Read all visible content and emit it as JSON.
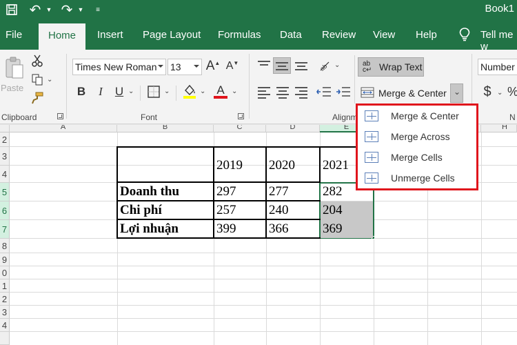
{
  "window": {
    "title": "Book1",
    "undo_icon": "↶",
    "redo_icon": "↷"
  },
  "tabs": [
    "File",
    "Home",
    "Insert",
    "Page Layout",
    "Formulas",
    "Data",
    "Review",
    "View",
    "Help"
  ],
  "tell_me": "Tell me w",
  "ribbon": {
    "clipboard": {
      "paste_label": "Paste",
      "group_label": "Clipboard"
    },
    "font": {
      "font_name": "Times New Roman",
      "font_size": "13",
      "bold": "B",
      "italic": "I",
      "underline": "U",
      "grow": "A",
      "shrink": "A",
      "font_color_letter": "A",
      "group_label": "Font",
      "highlight_color": "#ffff00",
      "font_color": "#e0141c"
    },
    "alignment": {
      "wrap_text_label": "Wrap Text",
      "wrap_text_icon": "ab c",
      "merge_center_label": "Merge & Center",
      "group_label": "Alignm"
    },
    "number": {
      "format": "Number",
      "currency": "$",
      "percent": "%",
      "group_label": "N"
    }
  },
  "merge_menu": {
    "items": [
      "Merge & Center",
      "Merge Across",
      "Merge Cells",
      "Unmerge Cells"
    ]
  },
  "columns": [
    "A",
    "B",
    "C",
    "D",
    "E",
    "H"
  ],
  "rows": [
    "2",
    "3",
    "4",
    "5",
    "6",
    "7",
    "8",
    "9",
    "0",
    "1",
    "2",
    "3",
    "4"
  ],
  "sheet": {
    "headers": [
      "2019",
      "2020",
      "2021"
    ],
    "data": [
      {
        "label": "Doanh thu",
        "values": [
          "297",
          "277",
          "282"
        ]
      },
      {
        "label": "Chi phí",
        "values": [
          "257",
          "240",
          "204"
        ]
      },
      {
        "label": "Lợi nhuận",
        "values": [
          "399",
          "366",
          "369"
        ]
      }
    ]
  },
  "colors": {
    "excel_green": "#217346",
    "highlight_red": "#e0141c",
    "selection_gray": "#c8c8c8"
  }
}
